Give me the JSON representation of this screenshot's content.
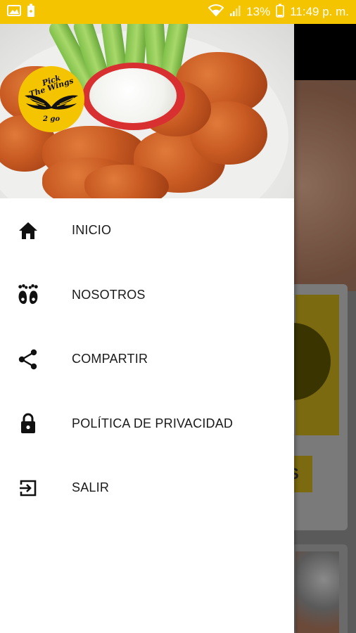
{
  "status_bar": {
    "battery": "13%",
    "time": "11:49 p. m.",
    "icons": [
      "image-icon",
      "battery-saver-icon",
      "wifi-icon",
      "signal-icon",
      "battery-icon"
    ]
  },
  "colors": {
    "accent": "#f4c400",
    "drawer_bg": "#ffffff",
    "text": "#1a1a1a"
  },
  "drawer": {
    "logo_text": {
      "line1": "Pick",
      "line2": "The Wings",
      "line3": "2 go"
    },
    "menu": [
      {
        "label": "INICIO",
        "icon": "home-icon"
      },
      {
        "label": "NOSOTROS",
        "icon": "paws-icon"
      },
      {
        "label": "COMPARTIR",
        "icon": "share-icon"
      },
      {
        "label": "POLÍTICA DE PRIVACIDAD",
        "icon": "lock-icon"
      },
      {
        "label": "SALIR",
        "icon": "exit-icon"
      }
    ]
  },
  "background": {
    "card_button_fragment": "S"
  }
}
